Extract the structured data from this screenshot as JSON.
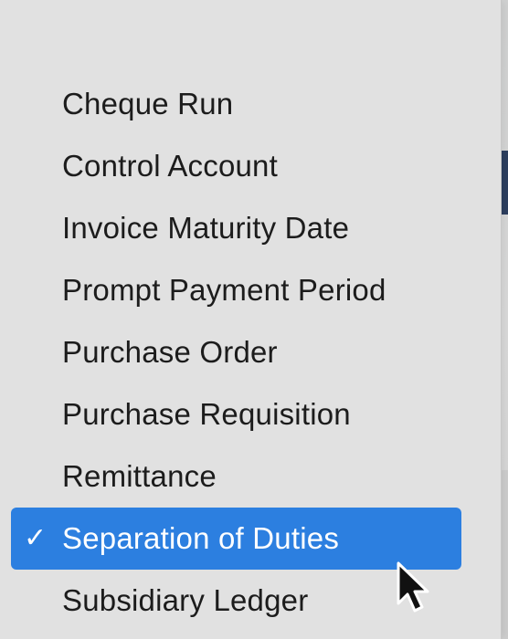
{
  "menu": {
    "items": [
      {
        "label": "Cheque Run"
      },
      {
        "label": "Control Account"
      },
      {
        "label": "Invoice Maturity Date"
      },
      {
        "label": "Prompt Payment Period"
      },
      {
        "label": "Purchase Order"
      },
      {
        "label": "Purchase Requisition"
      },
      {
        "label": "Remittance"
      },
      {
        "label": "Separation of Duties",
        "selected": true
      },
      {
        "label": "Subsidiary Ledger"
      }
    ],
    "checkmark": "✓",
    "selected_color": "#2c7fe0"
  },
  "icons": {
    "check": "checkmark-icon",
    "cursor": "mouse-pointer-icon"
  }
}
